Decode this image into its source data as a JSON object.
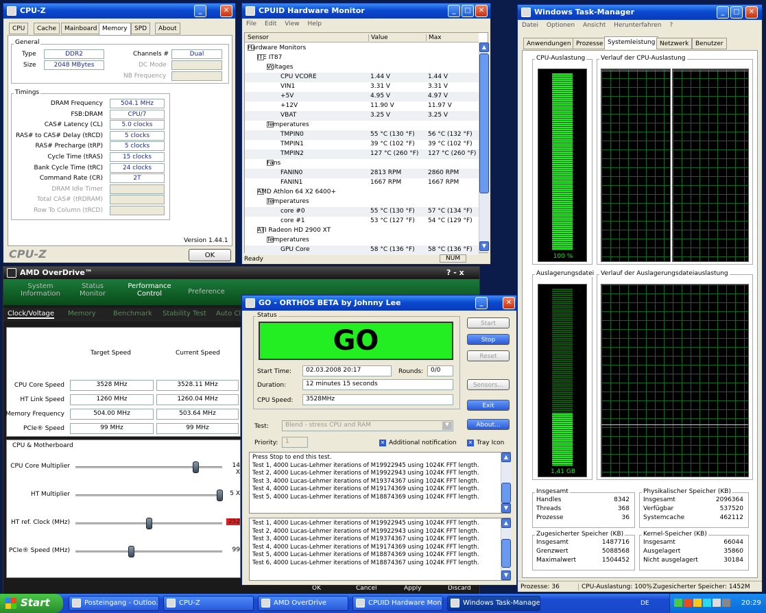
{
  "cpuz": {
    "title": "CPU-Z",
    "tabs": [
      "CPU",
      "Cache",
      "Mainboard",
      "Memory",
      "SPD",
      "About"
    ],
    "general_label": "General",
    "type_label": "Type",
    "type": "DDR2",
    "size_label": "Size",
    "size": "2048 MBytes",
    "channels_label": "Channels #",
    "channels": "Dual",
    "dcmode_label": "DC Mode",
    "nbfreq_label": "NB Frequency",
    "timings_label": "Timings",
    "timings": [
      {
        "label": "DRAM Frequency",
        "value": "504.1 MHz"
      },
      {
        "label": "FSB:DRAM",
        "value": "CPU/7"
      },
      {
        "label": "CAS# Latency (CL)",
        "value": "5.0 clocks"
      },
      {
        "label": "RAS# to CAS# Delay (tRCD)",
        "value": "5 clocks"
      },
      {
        "label": "RAS# Precharge (tRP)",
        "value": "5 clocks"
      },
      {
        "label": "Cycle Time (tRAS)",
        "value": "15 clocks"
      },
      {
        "label": "Bank Cycle Time (tRC)",
        "value": "24 clocks"
      },
      {
        "label": "Command Rate (CR)",
        "value": "2T"
      },
      {
        "label": "DRAM Idle Timer",
        "value": ""
      },
      {
        "label": "Total CAS# (tRDRAM)",
        "value": ""
      },
      {
        "label": "Row To Column (tRCD)",
        "value": ""
      }
    ],
    "version": "Version 1.44.1",
    "brand": "CPU-Z",
    "ok": "OK"
  },
  "hwmon": {
    "title": "CPUID Hardware Monitor",
    "menu": [
      "File",
      "Edit",
      "View",
      "Help"
    ],
    "headers": [
      "Sensor",
      "Value",
      "Max"
    ],
    "rows": [
      {
        "name": "Hardware Monitors",
        "value": "",
        "max": ""
      },
      {
        "name": "ITE IT87",
        "value": "",
        "max": ""
      },
      {
        "name": "Voltages",
        "value": "",
        "max": ""
      },
      {
        "name": "CPU VCORE",
        "value": "1.44 V",
        "max": "1.44 V"
      },
      {
        "name": "VIN1",
        "value": "3.31 V",
        "max": "3.31 V"
      },
      {
        "name": "+5V",
        "value": "4.95 V",
        "max": "4.97 V"
      },
      {
        "name": "+12V",
        "value": "11.90 V",
        "max": "11.97 V"
      },
      {
        "name": "VBAT",
        "value": "3.25 V",
        "max": "3.25 V"
      },
      {
        "name": "Temperatures",
        "value": "",
        "max": ""
      },
      {
        "name": "TMPIN0",
        "value": "55 °C  (130 °F)",
        "max": "56 °C  (132 °F)"
      },
      {
        "name": "TMPIN1",
        "value": "39 °C  (102 °F)",
        "max": "39 °C  (102 °F)"
      },
      {
        "name": "TMPIN2",
        "value": "127 °C  (260 °F)",
        "max": "127 °C  (260 °F)"
      },
      {
        "name": "Fans",
        "value": "",
        "max": ""
      },
      {
        "name": "FANIN0",
        "value": "2813 RPM",
        "max": "2860 RPM"
      },
      {
        "name": "FANIN1",
        "value": "1667 RPM",
        "max": "1667 RPM"
      },
      {
        "name": "AMD Athlon 64 X2 6400+",
        "value": "",
        "max": ""
      },
      {
        "name": "Temperatures",
        "value": "",
        "max": ""
      },
      {
        "name": "core #0",
        "value": "55 °C  (130 °F)",
        "max": "57 °C  (134 °F)"
      },
      {
        "name": "core #1",
        "value": "53 °C  (127 °F)",
        "max": "54 °C  (129 °F)"
      },
      {
        "name": "ATI Radeon HD 2900 XT",
        "value": "",
        "max": ""
      },
      {
        "name": "Temperatures",
        "value": "",
        "max": ""
      },
      {
        "name": "GPU Core",
        "value": "58 °C  (136 °F)",
        "max": "58 °C  (136 °F)"
      }
    ],
    "status": "Ready",
    "num": "NUM"
  },
  "overdrive": {
    "title": "AMD OverDrive™",
    "title_controls": "?   -   x",
    "tabs": [
      "System\nInformation",
      "Status\nMonitor",
      "Performance\nControl",
      "Preference"
    ],
    "subtabs": [
      "Clock/Voltage",
      "Memory",
      "Benchmark",
      "Stability Test",
      "Auto Cl"
    ],
    "target_label": "Target Speed",
    "current_label": "Current Speed",
    "speeds": [
      {
        "label": "CPU Core Speed",
        "target": "3528 MHz",
        "current": "3528.11 MHz"
      },
      {
        "label": "HT Link Speed",
        "target": "1260 MHz",
        "current": "1260.04 MHz"
      },
      {
        "label": "Memory Frequency",
        "target": "504.00 MHz",
        "current": "503.64 MHz"
      },
      {
        "label": "PCIe® Speed",
        "target": "99 MHz",
        "current": "99 MHz"
      }
    ],
    "cpu_mb_label": "CPU & Motherboard",
    "sliders": [
      {
        "label": "CPU Core Multiplier",
        "value": "14 X",
        "pos": 0.82
      },
      {
        "label": "HT Multiplier",
        "value": "5 X",
        "pos": 0.98
      },
      {
        "label": "HT ref. Clock (MHz)",
        "value": "252",
        "pos": 0.5
      },
      {
        "label": "PCIe® Speed (MHz)",
        "value": "99",
        "pos": 0.38
      }
    ],
    "buttons": [
      "OK",
      "Cancel",
      "Apply",
      "Discard"
    ]
  },
  "orthos": {
    "title": "GO - ORTHOS BETA by Johnny Lee",
    "status_label": "Status",
    "go": "GO",
    "start_time_label": "Start Time:",
    "start_time": "02.03.2008 20:17",
    "rounds_label": "Rounds:",
    "rounds": "0/0",
    "duration_label": "Duration:",
    "duration": "12 minutes 15 seconds",
    "cpu_speed_label": "CPU Speed:",
    "cpu_speed": "3528MHz",
    "test_label": "Test:",
    "test": "Blend - stress CPU and RAM",
    "priority_label": "Priority:",
    "priority": "1",
    "additional": "Additional notification",
    "tray": "Tray Icon",
    "buttons": {
      "start": "Start",
      "stop": "Stop",
      "reset": "Reset",
      "sensors": "Sensors...",
      "exit": "Exit",
      "about": "About..."
    },
    "log1": [
      "Press Stop to end this test.",
      "Test 1, 4000 Lucas-Lehmer iterations of M19922945 using 1024K FFT length.",
      "Test 2, 4000 Lucas-Lehmer iterations of M19922943 using 1024K FFT length.",
      "Test 3, 4000 Lucas-Lehmer iterations of M19374367 using 1024K FFT length.",
      "Test 4, 4000 Lucas-Lehmer iterations of M19174369 using 1024K FFT length.",
      "Test 5, 4000 Lucas-Lehmer iterations of M18874369 using 1024K FFT length."
    ],
    "log2": [
      "Test 1, 4000 Lucas-Lehmer iterations of M19922945 using 1024K FFT length.",
      "Test 2, 4000 Lucas-Lehmer iterations of M19922943 using 1024K FFT length.",
      "Test 3, 4000 Lucas-Lehmer iterations of M19374367 using 1024K FFT length.",
      "Test 4, 4000 Lucas-Lehmer iterations of M19174369 using 1024K FFT length.",
      "Test 5, 4000 Lucas-Lehmer iterations of M18874369 using 1024K FFT length.",
      "Test 6, 4000 Lucas-Lehmer iterations of M18874367 using 1024K FFT length."
    ]
  },
  "taskmgr": {
    "title": "Windows Task-Manager",
    "menu": [
      "Datei",
      "Optionen",
      "Ansicht",
      "Herunterfahren",
      "?"
    ],
    "tabs": [
      "Anwendungen",
      "Prozesse",
      "Systemleistung",
      "Netzwerk",
      "Benutzer"
    ],
    "cpu_usage_label": "CPU-Auslastung",
    "cpu_usage": "100 %",
    "cpu_history_label": "Verlauf der CPU-Auslastung",
    "pf_label": "Auslagerungsdatei",
    "pf_usage": "1,41 GB",
    "pf_history_label": "Verlauf der Auslagerungsdateiauslastung",
    "totals": {
      "title": "Insgesamt",
      "rows": [
        [
          "Handles",
          "8342"
        ],
        [
          "Threads",
          "368"
        ],
        [
          "Prozesse",
          "36"
        ]
      ]
    },
    "physical": {
      "title": "Physikalischer Speicher (KB)",
      "rows": [
        [
          "Insgesamt",
          "2096364"
        ],
        [
          "Verfügbar",
          "537520"
        ],
        [
          "Systemcache",
          "462112"
        ]
      ]
    },
    "commit": {
      "title": "Zugesicherter Speicher (KB)",
      "rows": [
        [
          "Insgesamt",
          "1487716"
        ],
        [
          "Grenzwert",
          "5088568"
        ],
        [
          "Maximalwert",
          "1504452"
        ]
      ]
    },
    "kernel": {
      "title": "Kernel-Speicher (KB)",
      "rows": [
        [
          "Insgesamt",
          "66044"
        ],
        [
          "Ausgelagert",
          "35860"
        ],
        [
          "Nicht ausgelagert",
          "30184"
        ]
      ]
    },
    "status": [
      "Prozesse: 36",
      "CPU-Auslastung: 100%",
      "Zugesicherter Speicher: 1452M"
    ]
  },
  "taskbar": {
    "start": "Start",
    "items": [
      "Posteingang - Outloo...",
      "CPU-Z",
      "AMD OverDrive",
      "CPUID Hardware Mon...",
      "Windows Task-Manager"
    ],
    "lang": "DE",
    "clock": "20:29"
  },
  "colors": {
    "go_green": "#22ee22",
    "graph_green": "#22ee22",
    "xp_blue": "#2a5ad8"
  }
}
